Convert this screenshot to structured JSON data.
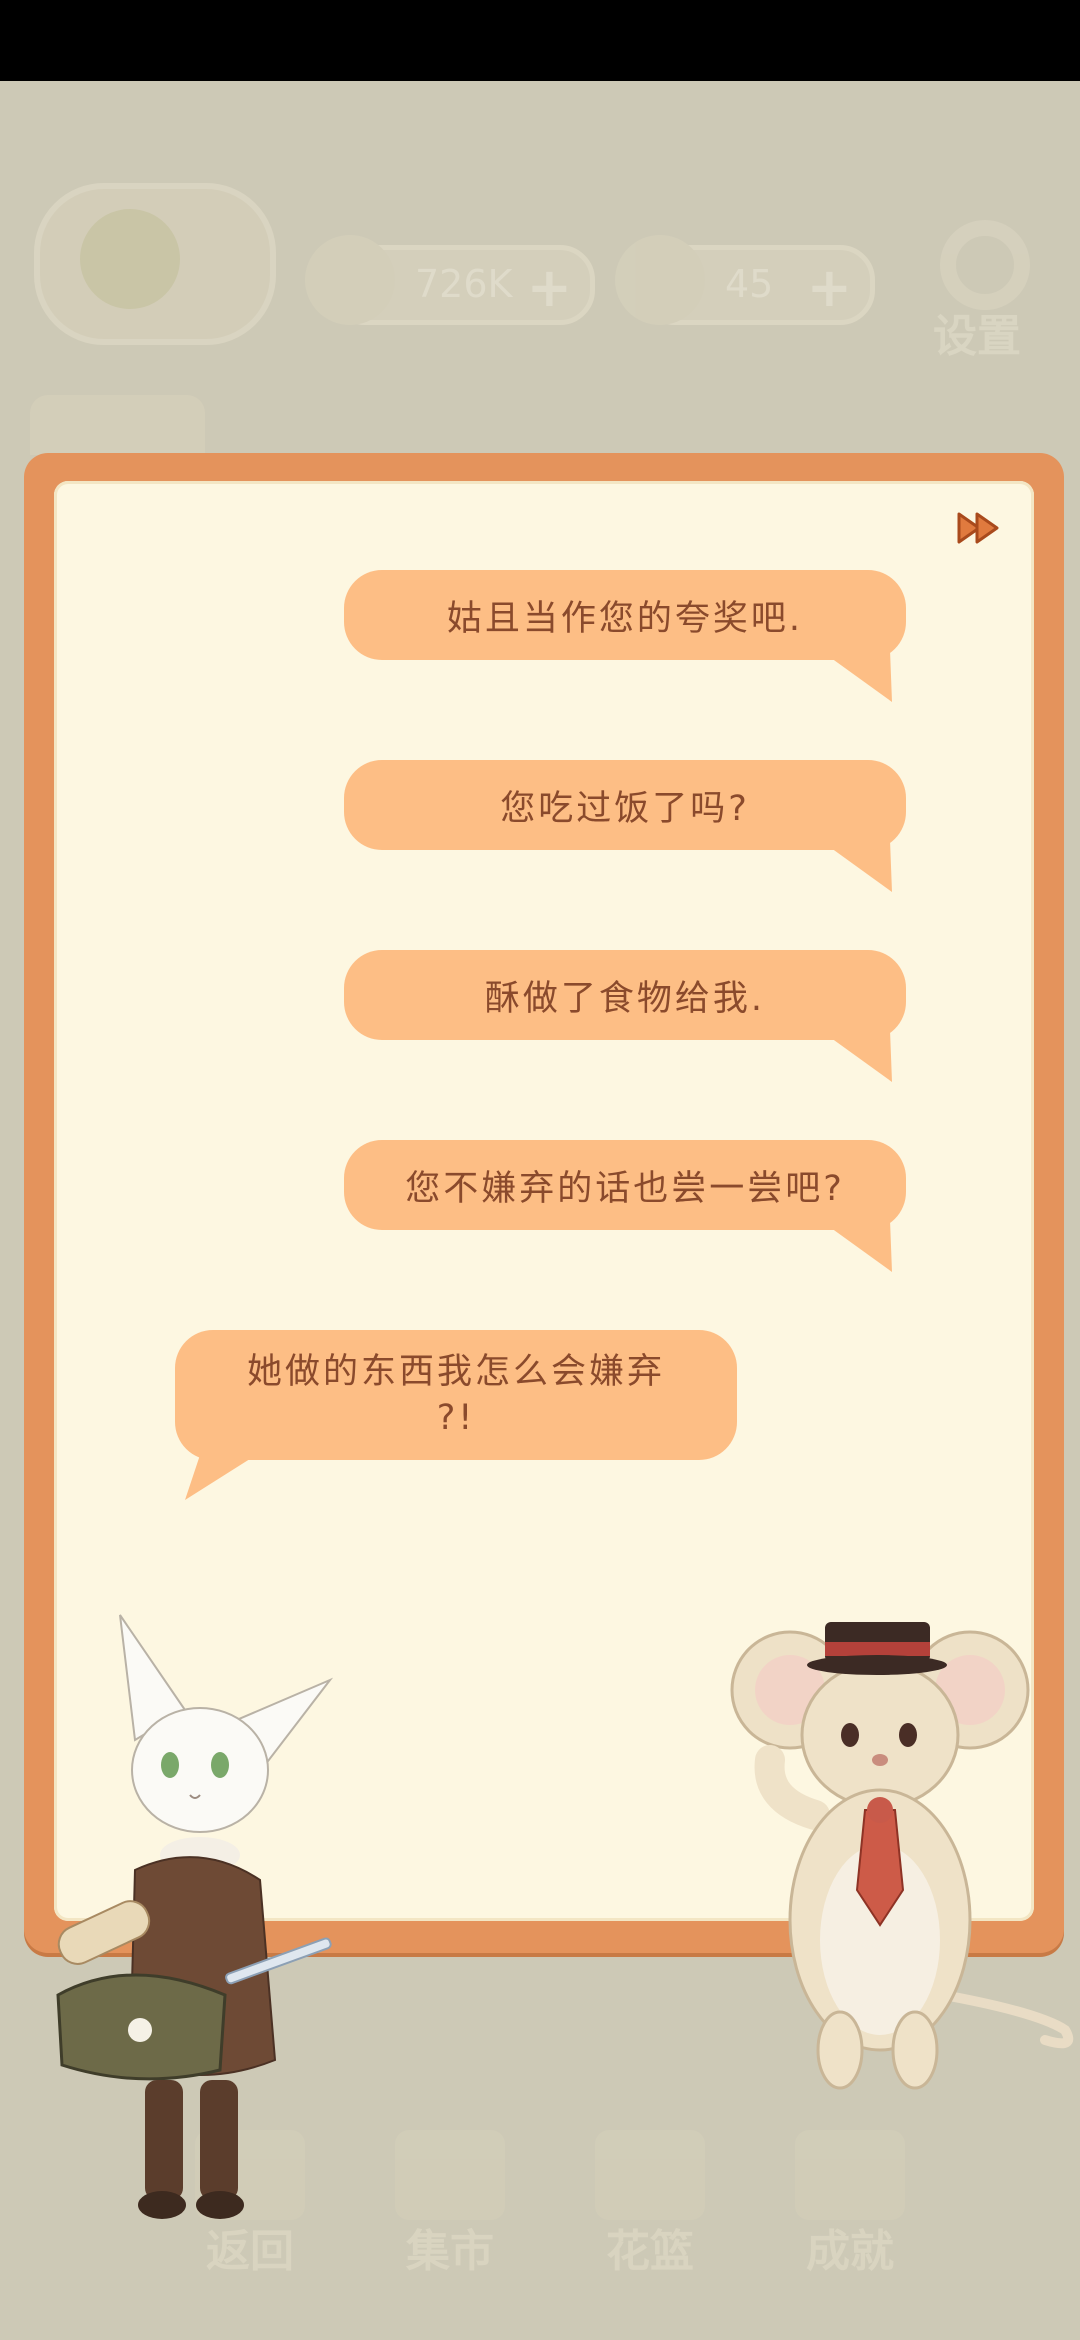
{
  "hud": {
    "fish_count": "726K",
    "cake_count": "45",
    "settings_label": "设置",
    "plus_icon": "+"
  },
  "dialog": {
    "skip_icon": "fast-forward-icon",
    "messages": [
      {
        "side": "right",
        "text": "姑且当作您的夸奖吧."
      },
      {
        "side": "right",
        "text": "您吃过饭了吗?"
      },
      {
        "side": "right",
        "text": "酥做了食物给我."
      },
      {
        "side": "right",
        "text": "您不嫌弃的话也尝一尝吧?"
      },
      {
        "side": "left",
        "line1": "她做的东西我怎么会嫌弃",
        "line2": "?!"
      }
    ]
  },
  "nav": {
    "back": "返回",
    "market": "集市",
    "basket": "花篮",
    "achievements": "成就"
  },
  "colors": {
    "panel_border": "#e4935c",
    "panel_fill": "#fdf7e1",
    "bubble": "#fdbe85",
    "bubble_text": "#8a4a2c"
  }
}
